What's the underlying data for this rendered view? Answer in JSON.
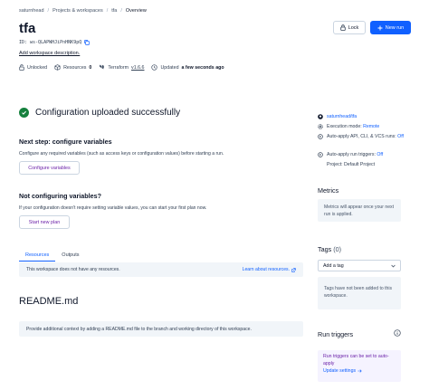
{
  "breadcrumb": {
    "items": [
      "saturnhead",
      "Projects & workspaces",
      "tfa"
    ],
    "current": "Overview",
    "separator": "/"
  },
  "header": {
    "title": "tfa",
    "lock_label": "Lock",
    "new_run_label": "New run"
  },
  "workspace": {
    "id_label": "ID:",
    "id_value": "ws-QLAPWHJiPnHNK9pQ",
    "add_description": "Add workspace description."
  },
  "meta": {
    "lock_status": "Unlocked",
    "resources_label": "Resources",
    "resources_count": "0",
    "terraform_label": "Terraform",
    "terraform_version": "v1.6.6",
    "updated_prefix": "Updated",
    "updated_value": "a few seconds ago"
  },
  "main": {
    "success_heading": "Configuration uploaded successfully",
    "next_step_heading": "Next step: configure variables",
    "next_step_text": "Configure any required variables (such as access keys or configuration values) before starting a run.",
    "configure_button": "Configure variables",
    "not_configuring_heading": "Not configuring variables?",
    "not_configuring_text": "If your configuration doesn't require setting variable values, you can start your first plan now.",
    "start_plan_button": "Start new plan",
    "tabs": [
      {
        "label": "Resources"
      },
      {
        "label": "Outputs"
      }
    ],
    "resources_empty_text": "This workspace does not have any resources.",
    "learn_resources_link": "Learn about resources.",
    "readme_title": "README.md",
    "readme_text": "Provide additional context by adding a README.md file to the branch and working directory of this workspace."
  },
  "sidebar": {
    "repo": "saturnhead/tfa",
    "execution_mode_label": "Execution mode:",
    "execution_mode_value": "Remote",
    "auto_apply_vcs_label": "Auto-apply API, CLI, & VCS runs:",
    "auto_apply_vcs_value": "Off",
    "auto_apply_triggers_label": "Auto-apply run triggers:",
    "auto_apply_triggers_value": "Off",
    "project_label": "Project:",
    "project_value": "Default Project",
    "metrics_heading": "Metrics",
    "metrics_text": "Metrics will appear once your next run is applied.",
    "tags_heading": "Tags",
    "tags_count": "(0)",
    "add_tag_label": "Add a tag",
    "tags_empty_text": "Tags have not been added to this workspace.",
    "run_triggers_heading": "Run triggers",
    "run_triggers_text": "Run triggers can be set to auto-apply",
    "update_settings_link": "Update settings"
  },
  "colors": {
    "accent": "#1060ff",
    "success": "#15803d",
    "purple": "#6b21a8"
  }
}
